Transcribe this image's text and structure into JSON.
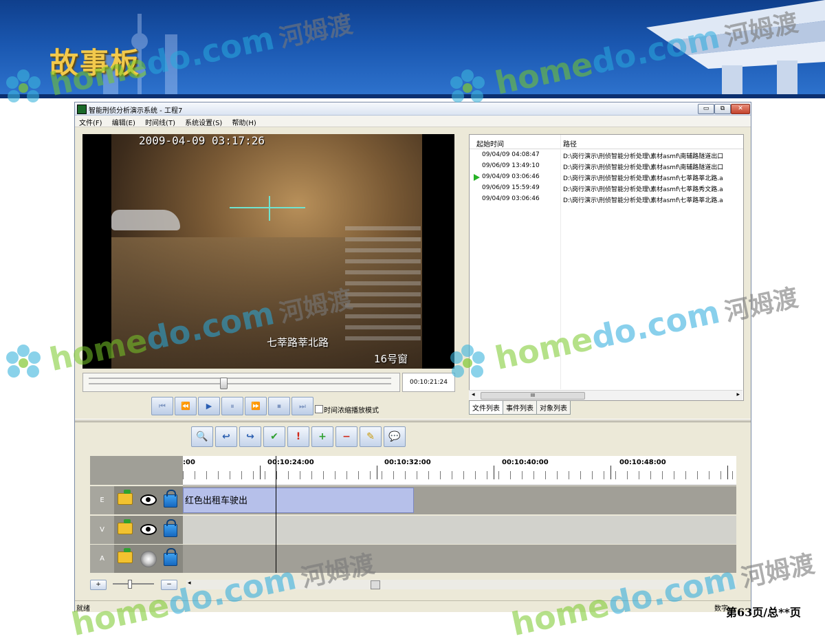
{
  "slide": {
    "title": "故事板",
    "page_number": "第63页/总**页"
  },
  "watermark": {
    "part1": "home",
    "part2": "do.com",
    "cn": "河姆渡"
  },
  "app": {
    "title": "智能刑侦分析演示系统 - 工程7",
    "window_buttons": {
      "minimize": "▭",
      "maximize": "⧉",
      "close": "✕"
    },
    "menu": [
      "文件(F)",
      "编辑(E)",
      "时间线(T)",
      "系统设置(S)",
      "帮助(H)"
    ]
  },
  "video": {
    "osd_datetime": "2009-04-09   03:17:26",
    "osd_location": "七莘路莘北路",
    "osd_window": "16号窗",
    "current_time": "00:10:21:24",
    "seek_position": 0.68
  },
  "playback_controls": [
    "⏮",
    "⏪",
    "▶",
    "⏸",
    "⏩",
    "⏹",
    "⏭"
  ],
  "compress_mode_label": "时间浓缩播放模式",
  "file_list": {
    "columns": [
      "起始时间",
      "路径"
    ],
    "rows": [
      {
        "time": "09/04/09 04:08:47",
        "path": "D:\\岗行演示\\刑侦智能分析处理\\素材asmf\\南辅路隧道出口",
        "playing": false
      },
      {
        "time": "09/06/09 13:49:10",
        "path": "D:\\岗行演示\\刑侦智能分析处理\\素材asmf\\南辅路隧道出口",
        "playing": false
      },
      {
        "time": "09/04/09 03:06:46",
        "path": "D:\\岗行演示\\刑侦智能分析处理\\素材asmf\\七莘路莘北路.a",
        "playing": true
      },
      {
        "time": "09/06/09 15:59:49",
        "path": "D:\\岗行演示\\刑侦智能分析处理\\素材asmf\\七莘路秀文路.a",
        "playing": false
      },
      {
        "time": "09/04/09 03:06:46",
        "path": "D:\\岗行演示\\刑侦智能分析处理\\素材asmf\\七莘路莘北路.a",
        "playing": false
      }
    ],
    "scroll_thumb": "III",
    "scroll_left": "◂",
    "scroll_right": "▸"
  },
  "tabs": [
    "文件列表",
    "事件列表",
    "对象列表"
  ],
  "timeline_toolbar": [
    "🔍",
    "↩",
    "↪",
    "✔",
    "!",
    "+",
    "−",
    "✎",
    "💬"
  ],
  "timeline": {
    "ruler_labels": [
      ":00",
      "00:10:24:00",
      "00:10:32:00",
      "00:10:40:00",
      "00:10:48:00"
    ],
    "tracks": [
      {
        "label": "E",
        "clip": "红色出租车驶出"
      },
      {
        "label": "V"
      },
      {
        "label": "A"
      }
    ],
    "zoom_in": "+",
    "zoom_out": "−",
    "scroll_left": "◂"
  },
  "status": {
    "left": "就绪",
    "right": "数字"
  },
  "colors": {
    "title_gold": "#f2c94c",
    "header_blue": "#1a57b0",
    "clip_fill": "#b6c0ea",
    "play_arrow": "#26b226"
  }
}
